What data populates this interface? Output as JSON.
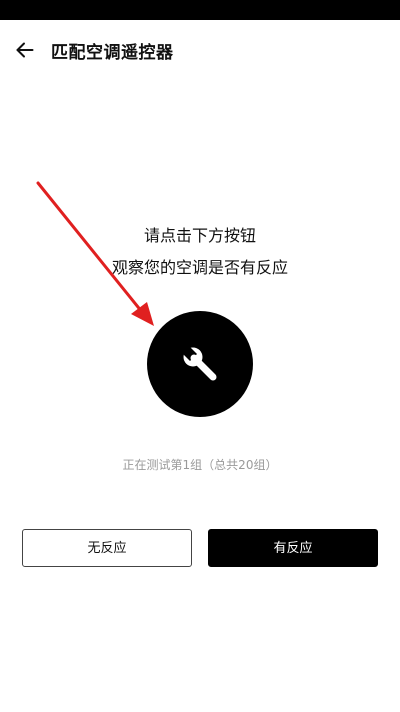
{
  "header": {
    "title": "匹配空调遥控器",
    "back_icon": "arrow-left-icon"
  },
  "instructions": {
    "line1": "请点击下方按钮",
    "line2": "观察您的空调是否有反应"
  },
  "test_button": {
    "icon": "wrench-icon"
  },
  "progress": {
    "text": "正在测试第1组（总共20组）",
    "current_group": 1,
    "total_groups": 20
  },
  "actions": {
    "no_response_label": "无反应",
    "has_response_label": "有反应"
  },
  "annotation": {
    "type": "arrow",
    "color": "#e02020"
  },
  "colors": {
    "status_bar": "#000000",
    "primary": "#000000",
    "secondary_text": "#9a9a9a"
  }
}
